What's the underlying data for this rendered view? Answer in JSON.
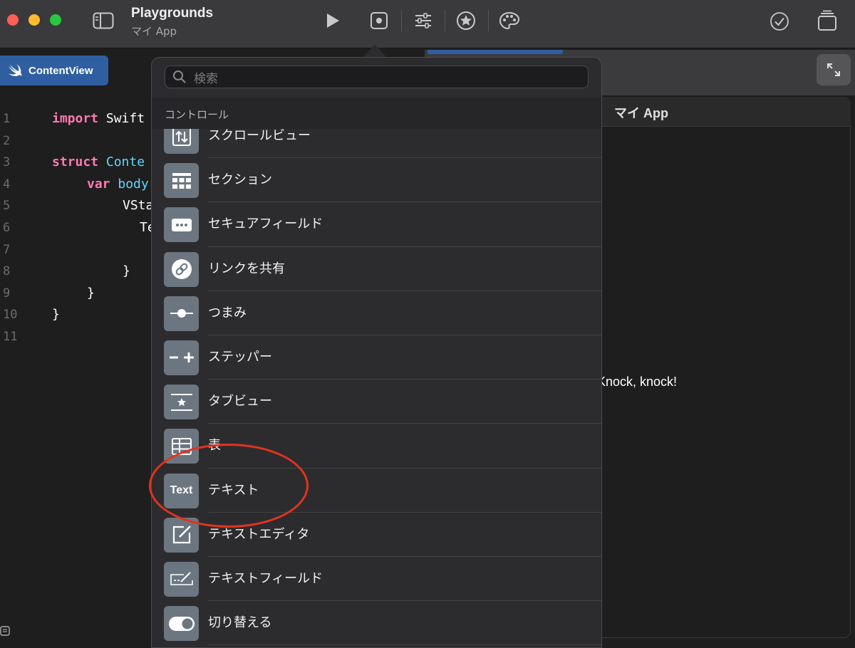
{
  "window": {
    "title": "Playgrounds",
    "subtitle": "マイ App"
  },
  "editor": {
    "tab_label": "ContentView",
    "line_numbers": [
      "1",
      "2",
      "3",
      "4",
      "5",
      "6",
      "7",
      "8",
      "9",
      "10",
      "11"
    ],
    "code": {
      "l1_kw": "import",
      "l1_rest": " Swift",
      "l3_kw": "struct",
      "l3_type": " Conte",
      "l4_kw": "var",
      "l4_rest": " body",
      "l5": "VSta",
      "l6": "Te",
      "l8": "}",
      "l9": "}",
      "l10": "}"
    }
  },
  "popover": {
    "search_placeholder": "検索",
    "section_label": "コントロール",
    "items": [
      {
        "label": "スクロールビュー",
        "icon": "scroll-arrows-icon"
      },
      {
        "label": "セクション",
        "icon": "section-grid-icon"
      },
      {
        "label": "セキュアフィールド",
        "icon": "secure-field-dots-icon"
      },
      {
        "label": "リンクを共有",
        "icon": "link-icon"
      },
      {
        "label": "つまみ",
        "icon": "slider-icon"
      },
      {
        "label": "ステッパー",
        "icon": "stepper-icon"
      },
      {
        "label": "タブビュー",
        "icon": "tab-star-icon"
      },
      {
        "label": "表",
        "icon": "table-icon"
      },
      {
        "label": "テキスト",
        "icon": "text-icon",
        "icon_text": "Text"
      },
      {
        "label": "テキストエディタ",
        "icon": "text-editor-icon"
      },
      {
        "label": "テキストフィールド",
        "icon": "text-field-icon"
      },
      {
        "label": "切り替える",
        "icon": "toggle-icon"
      }
    ]
  },
  "preview": {
    "title": "マイ App",
    "text": "Knock, knock!"
  },
  "colors": {
    "accent": "#2f5fa0",
    "annotation": "#e1331f",
    "keyword": "#ff7ab2",
    "type": "#5dd8ff"
  }
}
